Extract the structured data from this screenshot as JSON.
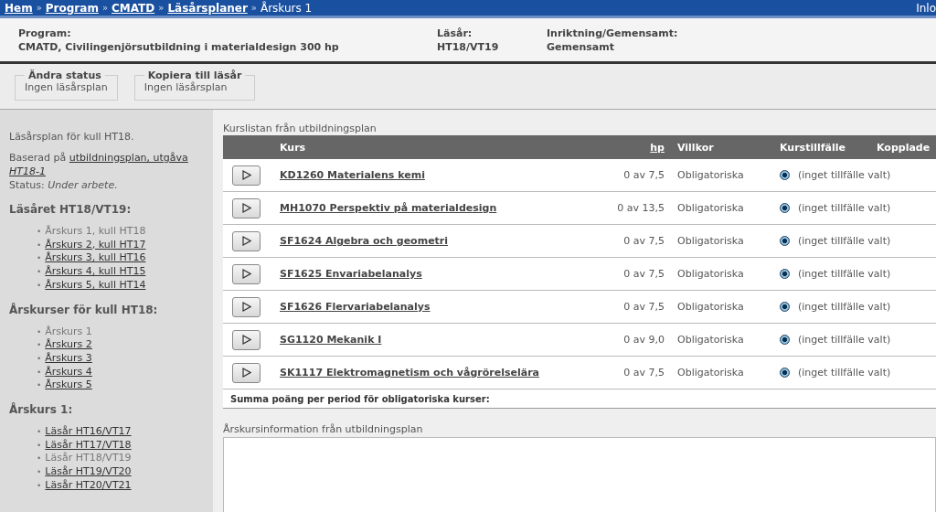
{
  "breadcrumb": [
    {
      "label": "Hem",
      "link": true
    },
    {
      "separator": "»",
      "label": "Program",
      "link": true
    },
    {
      "separator": "»",
      "label": "CMATD",
      "link": true
    },
    {
      "separator": "»",
      "label": "Läsårsplaner",
      "link": true
    },
    {
      "separator": "»",
      "label": "Årskurs 1",
      "link": false
    }
  ],
  "login": "Inlo",
  "header": [
    {
      "label": "Program:",
      "value": "CMATD, Civilingenjörsutbildning i materialdesign 300 hp"
    },
    {
      "label": "Läsår:",
      "value": "HT18/VT19"
    },
    {
      "label": "Inriktning/Gemensamt:",
      "value": "Gemensamt"
    }
  ],
  "actions": [
    {
      "legend": "Ändra status",
      "text": "Ingen läsårsplan"
    },
    {
      "legend": "Kopiera till läsår",
      "text": "Ingen läsårsplan"
    }
  ],
  "sidebar": {
    "intro": "Läsårsplan för kull HT18.",
    "based_on_prefix": "Baserad på",
    "based_on_link": "utbildningsplan, utgåva",
    "edition": "HT18-1",
    "status_label": "Status:",
    "status": "Under arbete.",
    "sections": [
      {
        "title": "Läsåret HT18/VT19:",
        "items": [
          {
            "bullet": "•",
            "label": "Årskurs 1, kull HT18",
            "selected": true
          },
          {
            "bullet": "•",
            "label": "Årskurs 2, kull HT17",
            "selected": false
          },
          {
            "bullet": "•",
            "label": "Årskurs 3, kull HT16",
            "selected": false
          },
          {
            "bullet": "•",
            "label": "Årskurs 4, kull HT15",
            "selected": false
          },
          {
            "bullet": "•",
            "label": "Årskurs 5, kull HT14",
            "selected": false
          }
        ]
      },
      {
        "title": "Årskurser för kull HT18:",
        "items": [
          {
            "bullet": "•",
            "label": "Årskurs 1",
            "selected": true
          },
          {
            "bullet": "•",
            "label": "Årskurs 2",
            "selected": false
          },
          {
            "bullet": "•",
            "label": "Årskurs 3",
            "selected": false
          },
          {
            "bullet": "•",
            "label": "Årskurs 4",
            "selected": false
          },
          {
            "bullet": "•",
            "label": "Årskurs 5",
            "selected": false
          }
        ]
      },
      {
        "title": "Årskurs 1:",
        "items": [
          {
            "bullet": "•",
            "label": "Läsår HT16/VT17",
            "selected": false
          },
          {
            "bullet": "•",
            "label": "Läsår HT17/VT18",
            "selected": false
          },
          {
            "bullet": "•",
            "label": "Läsår HT18/VT19",
            "selected": true
          },
          {
            "bullet": "•",
            "label": "Läsår HT19/VT20",
            "selected": false
          },
          {
            "bullet": "•",
            "label": "Läsår HT20/VT21",
            "selected": false
          }
        ]
      }
    ]
  },
  "course_list": {
    "caption": "Kurslistan från utbildningsplan",
    "columns": [
      "Kurs",
      "hp",
      "Villkor",
      "Kurstillfälle",
      "Kopplade"
    ],
    "rows": [
      {
        "course": "KD1260 Materialens kemi",
        "hp": "0 av 7,5",
        "condition": "Obligatoriska",
        "radio_checked": true,
        "occasion": "(inget tillfälle valt)"
      },
      {
        "course": "MH1070 Perspektiv på materialdesign",
        "hp": "0 av 13,5",
        "condition": "Obligatoriska",
        "radio_checked": true,
        "occasion": "(inget tillfälle valt)"
      },
      {
        "course": "SF1624 Algebra och geometri",
        "hp": "0 av 7,5",
        "condition": "Obligatoriska",
        "radio_checked": true,
        "occasion": "(inget tillfälle valt)"
      },
      {
        "course": "SF1625 Envariabelanalys",
        "hp": "0 av 7,5",
        "condition": "Obligatoriska",
        "radio_checked": true,
        "occasion": "(inget tillfälle valt)"
      },
      {
        "course": "SF1626 Flervariabelanalys",
        "hp": "0 av 7,5",
        "condition": "Obligatoriska",
        "radio_checked": true,
        "occasion": "(inget tillfälle valt)"
      },
      {
        "course": "SG1120 Mekanik I",
        "hp": "0 av 9,0",
        "condition": "Obligatoriska",
        "radio_checked": true,
        "occasion": "(inget tillfälle valt)"
      },
      {
        "course": "SK1117 Elektromagnetism och vågrörelselära",
        "hp": "0 av 7,5",
        "condition": "Obligatoriska",
        "radio_checked": true,
        "occasion": "(inget tillfälle valt)"
      }
    ],
    "summary": "Summa poäng per period för obligatoriska kurser:"
  },
  "info": {
    "caption": "Årskursinformation från utbildningsplan"
  }
}
